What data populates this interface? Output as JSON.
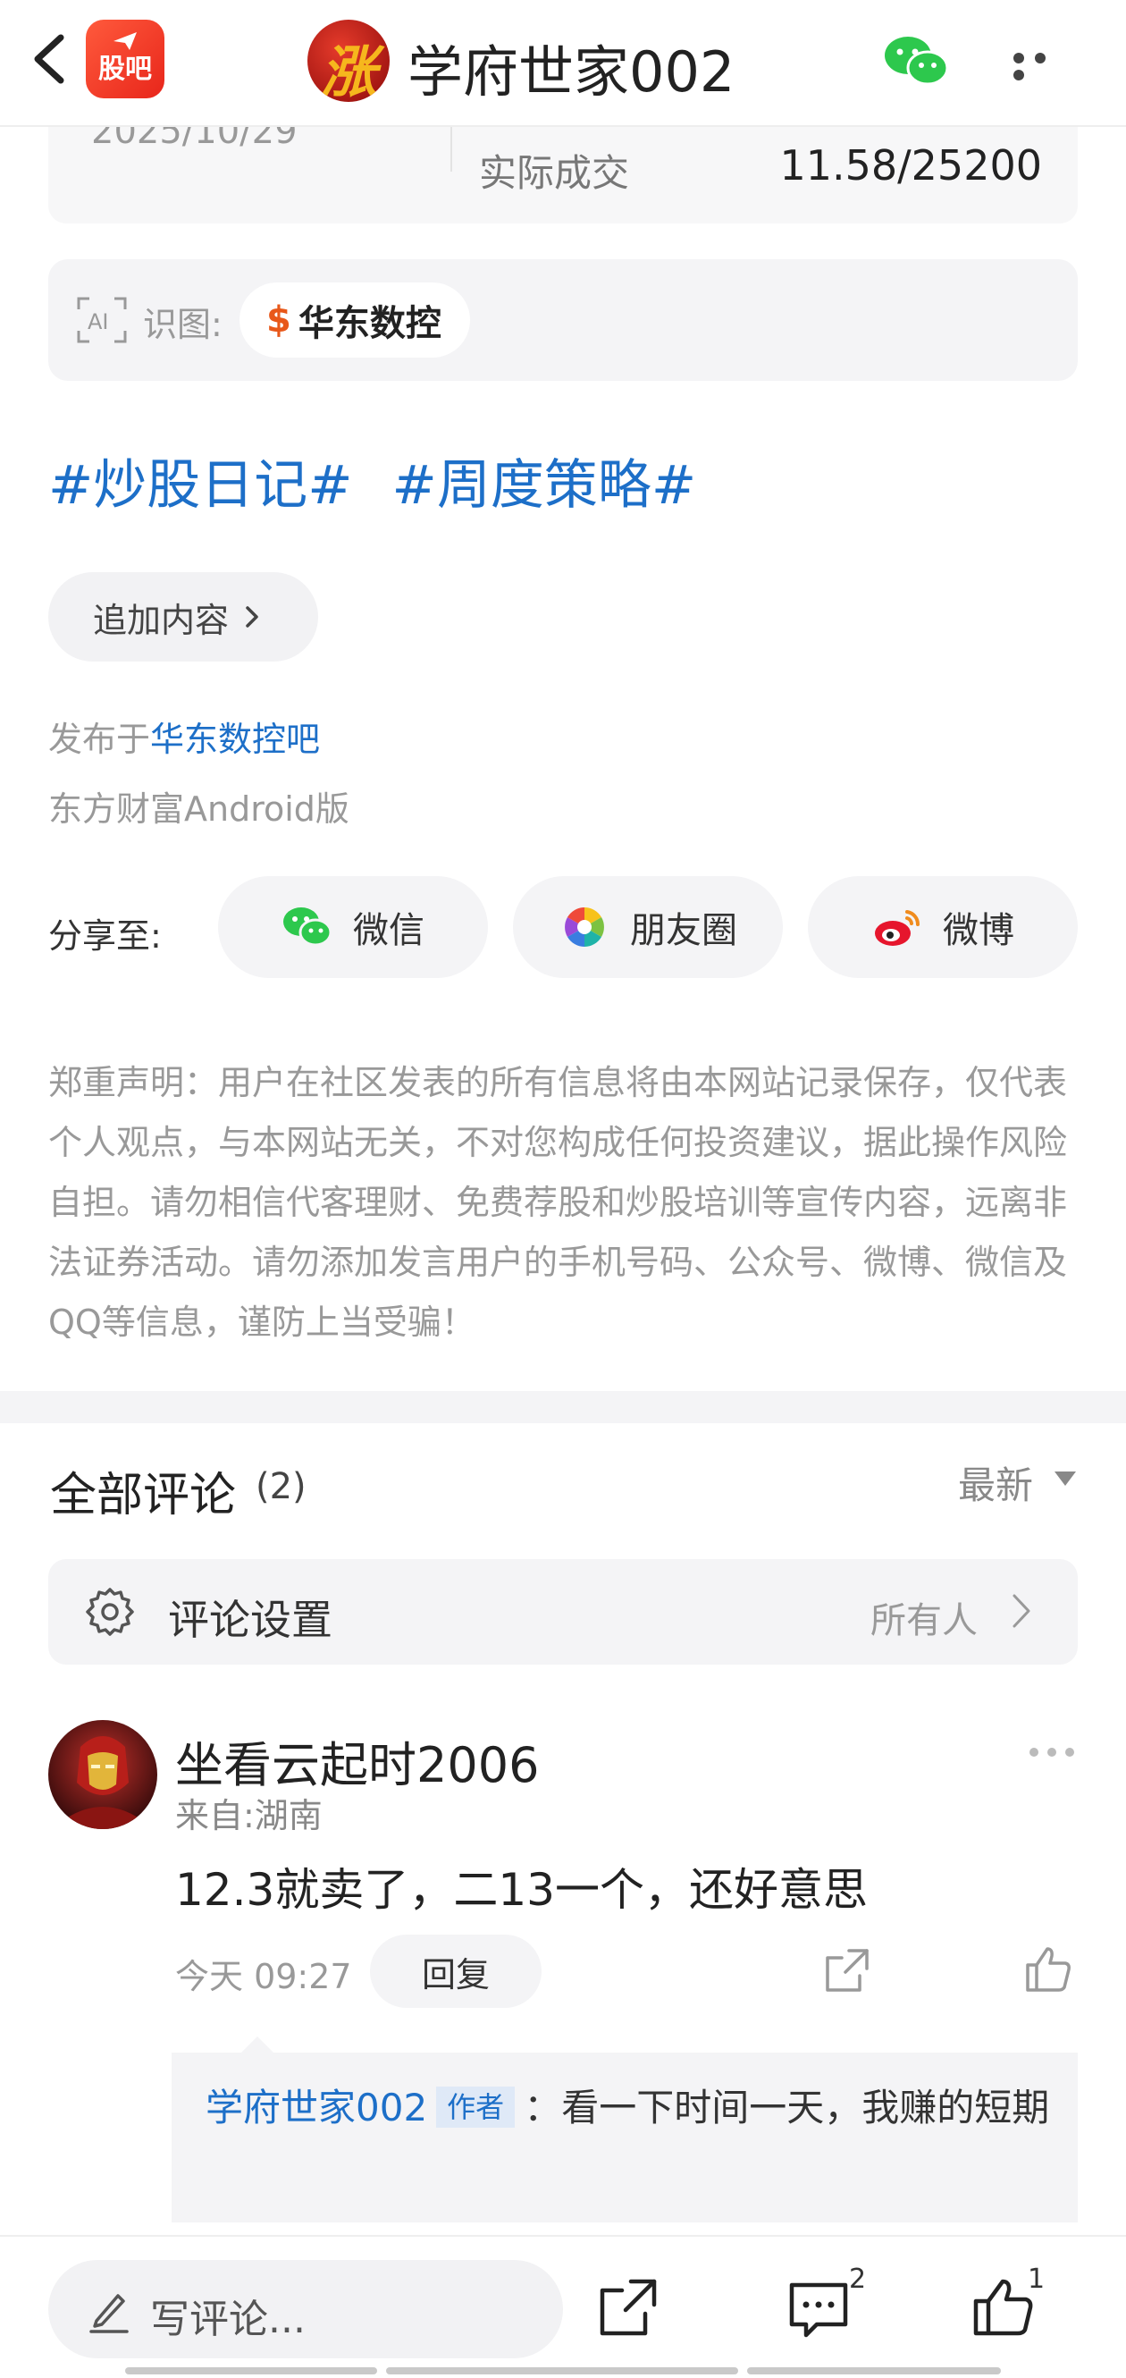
{
  "header": {
    "app_logo_text": "股吧",
    "avatar_char": "涨",
    "title": "学府世家002"
  },
  "trade_card": {
    "date": "2025/10/29",
    "label": "实际成交",
    "value": "11.58/25200"
  },
  "ai_recognition": {
    "label": "识图:",
    "stock_symbol": "$",
    "stock_name": "华东数控"
  },
  "tags": [
    "#炒股日记#",
    "#周度策略#"
  ],
  "add_content_label": "追加内容",
  "posted": {
    "prefix": "发布于",
    "forum": "华东数控吧",
    "client": "东方财富Android版"
  },
  "share": {
    "label": "分享至:",
    "targets": [
      {
        "label": "微信",
        "icon": "wechat-icon"
      },
      {
        "label": "朋友圈",
        "icon": "moments-icon"
      },
      {
        "label": "微博",
        "icon": "weibo-icon"
      }
    ]
  },
  "disclaimer": "郑重声明：用户在社区发表的所有信息将由本网站记录保存，仅代表个人观点，与本网站无关，不对您构成任何投资建议，据此操作风险自担。请勿相信代客理财、免费荐股和炒股培训等宣传内容，远离非法证券活动。请勿添加发言用户的手机号码、公众号、微博、微信及QQ等信息，谨防上当受骗！",
  "comments": {
    "title": "全部评论",
    "count": "(2)",
    "sort": "最新",
    "settings_label": "评论设置",
    "settings_value": "所有人",
    "items": [
      {
        "user": "坐看云起时2006",
        "location": "来自:湖南",
        "text": "12.3就卖了，二13一个，还好意思",
        "time": "今天 09:27",
        "reply_label": "回复",
        "reply": {
          "author": "学府世家002",
          "badge": "作者",
          "text": "：看一下时间一天，我赚的短期"
        }
      }
    ]
  },
  "bottom_bar": {
    "write_placeholder": "写评论...",
    "comment_count": "2",
    "like_count": "1"
  },
  "colors": {
    "link": "#1d6fc8",
    "brand": "#e8261b",
    "muted": "#999999"
  }
}
